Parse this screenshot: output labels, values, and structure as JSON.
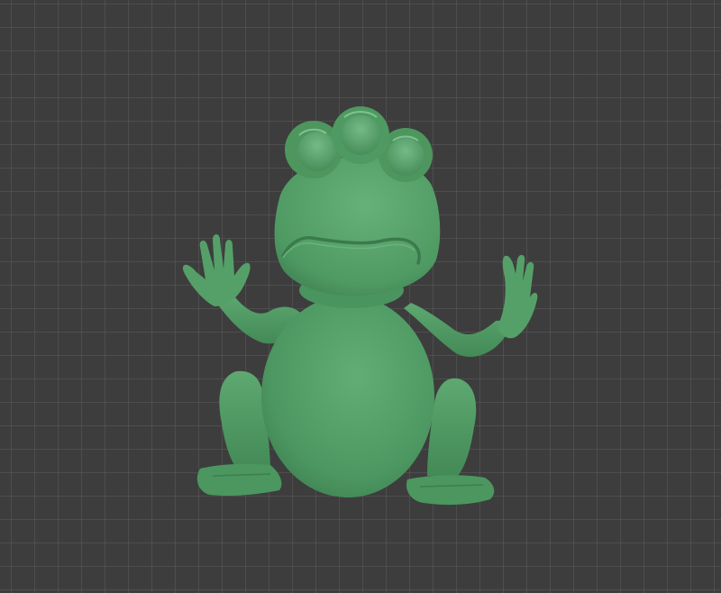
{
  "viewport": {
    "background_color": "#3d3d3d",
    "grid_color": "#5a5a5a",
    "show_grid": true
  },
  "model": {
    "subject": "frog-figure",
    "body_color": "#4f9a62",
    "shadow_color": "#3c7c4c",
    "highlight_color": "#6fb47f"
  }
}
